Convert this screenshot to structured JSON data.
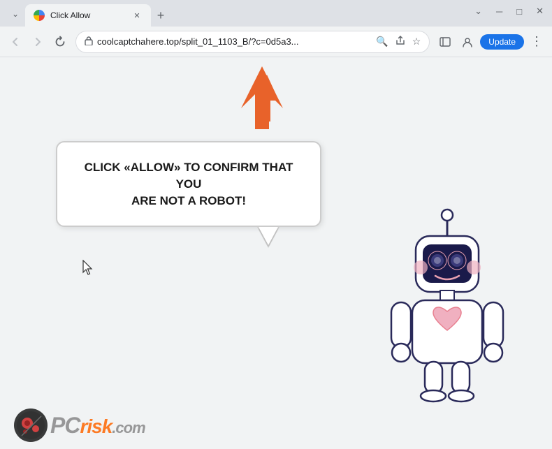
{
  "browser": {
    "window_title": "Click Allow",
    "tab_title": "Click Allow",
    "url": "coolcaptchahere.top/split_01_1103_B/?c=0d5a3...",
    "update_button_label": "Update",
    "new_tab_label": "+",
    "window_controls": {
      "minimize": "─",
      "maximize": "□",
      "close": "✕",
      "chevron": "⌄"
    }
  },
  "page": {
    "bubble_text_line1": "CLICK «ALLOW» TO CONFIRM THAT YOU",
    "bubble_text_line2": "ARE NOT A ROBOT!"
  },
  "watermark": {
    "text_pc": "PC",
    "text_risk": "risk",
    "text_com": ".com"
  },
  "icons": {
    "back": "←",
    "forward": "→",
    "refresh": "↻",
    "lock": "🔒",
    "search": "🔍",
    "share": "↗",
    "star": "☆",
    "sidebar": "▣",
    "profile": "👤",
    "dots": "⋮"
  }
}
